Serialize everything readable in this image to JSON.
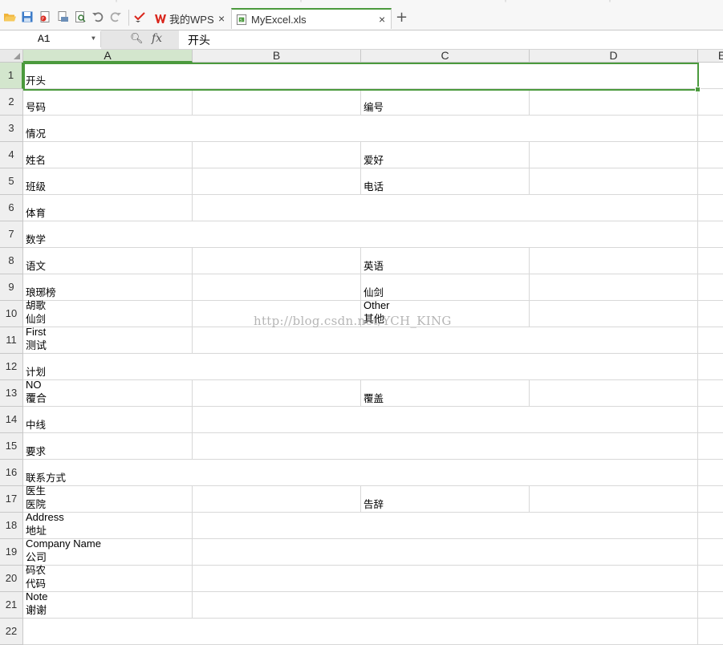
{
  "tabs": [
    {
      "label": "我的WPS",
      "active": false
    },
    {
      "label": "MyExcel.xls",
      "active": true
    }
  ],
  "formula_bar": {
    "cell_ref": "A1",
    "value": "开头"
  },
  "columns": [
    "A",
    "B",
    "C",
    "D",
    "E"
  ],
  "selected": {
    "column": "A",
    "row": 1
  },
  "rows": [
    {
      "num": "1",
      "a": "开头"
    },
    {
      "num": "2",
      "a": "号码",
      "c": "编号"
    },
    {
      "num": "3",
      "a": "情况"
    },
    {
      "num": "4",
      "a": "姓名",
      "c": "爱好"
    },
    {
      "num": "5",
      "a": "班级",
      "c": "电话"
    },
    {
      "num": "6",
      "a": "体育"
    },
    {
      "num": "7",
      "a": "数学"
    },
    {
      "num": "8",
      "a": "语文",
      "c": "英语"
    },
    {
      "num": "9",
      "a": "琅琊榜",
      "c": "仙剑"
    },
    {
      "num": "10",
      "a": "胡歌\n仙剑",
      "c": "Other\n其他"
    },
    {
      "num": "11",
      "a": "First\n测试"
    },
    {
      "num": "12",
      "a": "计划"
    },
    {
      "num": "13",
      "a": "NO\n覆合",
      "c": "覆盖"
    },
    {
      "num": "14",
      "a": "中线"
    },
    {
      "num": "15",
      "a": "要求"
    },
    {
      "num": "16",
      "a": "联系方式"
    },
    {
      "num": "17",
      "a": "医生\n医院",
      "c": "告辞"
    },
    {
      "num": "18",
      "a": "Address\n地址"
    },
    {
      "num": "19",
      "a": "Company Name\n公司"
    },
    {
      "num": "20",
      "a": "码农\n代码"
    },
    {
      "num": "21",
      "a": "Note\n谢谢"
    },
    {
      "num": "22",
      "a": ""
    }
  ],
  "watermark": "http://blog.csdn.net/YCH_KING",
  "colors": {
    "accent": "#4b9a3d",
    "header_bg": "#efefef",
    "selected_header_bg": "#d3e6cd",
    "wps_red": "#d9261c"
  }
}
